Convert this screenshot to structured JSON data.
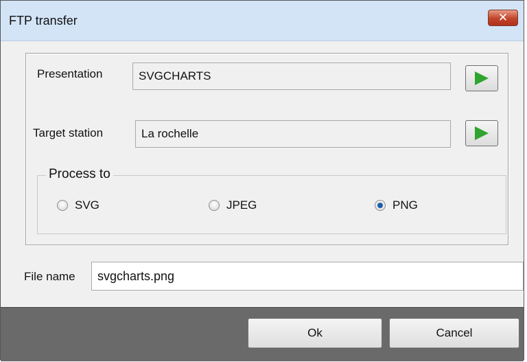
{
  "window": {
    "title": "FTP transfer"
  },
  "presentation": {
    "label": "Presentation",
    "value": "SVGCHARTS"
  },
  "target_station": {
    "label": "Target station",
    "value": "La rochelle"
  },
  "process_to": {
    "legend": "Process to",
    "options": [
      {
        "label": "SVG",
        "checked": false
      },
      {
        "label": "JPEG",
        "checked": false
      },
      {
        "label": "PNG",
        "checked": true
      }
    ]
  },
  "file_name": {
    "label": "File name",
    "value": "svgcharts.png"
  },
  "buttons": {
    "ok": "Ok",
    "cancel": "Cancel"
  },
  "icons": {
    "close": "close-icon",
    "play": "play-arrow-icon"
  },
  "colors": {
    "play_arrow": "#2fa52f",
    "close_button": "#c0442a",
    "bottom_bar": "#6a6a6a"
  }
}
